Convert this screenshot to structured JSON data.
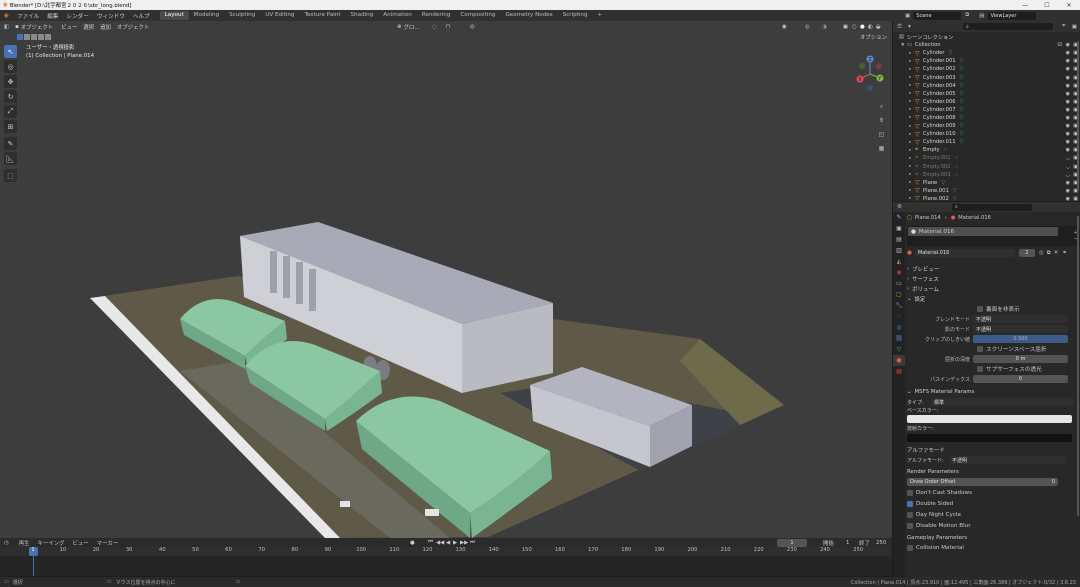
{
  "window": {
    "title": "Blender* [D:\\北宇都宮２０２６\\sbr_long.blend]",
    "controls": [
      "—",
      "☐",
      "✕"
    ]
  },
  "menu": {
    "items": [
      "ファイル",
      "編集",
      "レンダー",
      "ウィンドウ",
      "ヘルプ"
    ]
  },
  "workspaces": {
    "tabs": [
      "Layout",
      "Modeling",
      "Sculpting",
      "UV Editing",
      "Texture Paint",
      "Shading",
      "Animation",
      "Rendering",
      "Compositing",
      "Geometry Nodes",
      "Scripting"
    ],
    "active": "Layout",
    "add": "+"
  },
  "top_right": {
    "scene": "Scene",
    "view_layer": "ViewLayer"
  },
  "viewport": {
    "mode": "オブジェクト",
    "menus": [
      "ビュー",
      "選択",
      "追加",
      "オブジェクト"
    ],
    "transform": "グロ...",
    "options": "オプション",
    "info_line1": "ユーザー・透視投影",
    "info_line2": "(1) Collection | Plane.014",
    "gizmo_axes": {
      "x": "X",
      "y": "Y",
      "z": "Z"
    }
  },
  "toolbar": {
    "tools": [
      "select-tool",
      "cursor-tool",
      "move-tool",
      "rotate-tool",
      "scale-tool",
      "transform-tool",
      "annotate-tool",
      "measure-tool",
      "add-cube-tool"
    ]
  },
  "timeline": {
    "menus": [
      "再生",
      "キーイング",
      "ビュー",
      "マーカー"
    ],
    "current_frame": "1",
    "start_label": "開始",
    "start": "1",
    "end_label": "終了",
    "end": "250",
    "ticks": [
      "1",
      "10",
      "20",
      "30",
      "40",
      "50",
      "60",
      "70",
      "80",
      "90",
      "100",
      "110",
      "120",
      "130",
      "140",
      "150",
      "160",
      "170",
      "180",
      "190",
      "200",
      "210",
      "220",
      "230",
      "240",
      "250"
    ]
  },
  "statusbar": {
    "left": "選択",
    "mid": "マウス位置を視点の中心に",
    "right": "Collection | Plane.014 | 頂点:23,910 | 面:12,495 | 三角面:26,389 | オブジェクト:0/32 | 3.6.23"
  },
  "outliner": {
    "root": "シーンコレクション",
    "collection": "Collection",
    "items": [
      {
        "name": "Cylinder",
        "kind": "mesh",
        "visible": true
      },
      {
        "name": "Cylinder.001",
        "kind": "mesh",
        "visible": true
      },
      {
        "name": "Cylinder.002",
        "kind": "mesh",
        "visible": true
      },
      {
        "name": "Cylinder.003",
        "kind": "mesh",
        "visible": true
      },
      {
        "name": "Cylinder.004",
        "kind": "mesh",
        "visible": true
      },
      {
        "name": "Cylinder.005",
        "kind": "mesh",
        "visible": true
      },
      {
        "name": "Cylinder.006",
        "kind": "mesh",
        "visible": true
      },
      {
        "name": "Cylinder.007",
        "kind": "mesh",
        "visible": true
      },
      {
        "name": "Cylinder.008",
        "kind": "mesh",
        "visible": true
      },
      {
        "name": "Cylinder.009",
        "kind": "mesh",
        "visible": true
      },
      {
        "name": "Cylinder.010",
        "kind": "mesh",
        "visible": true
      },
      {
        "name": "Cylinder.011",
        "kind": "mesh",
        "visible": true
      },
      {
        "name": "Empty",
        "kind": "empty",
        "visible": true
      },
      {
        "name": "Empty.001",
        "kind": "empty",
        "visible": false
      },
      {
        "name": "Empty.002",
        "kind": "empty",
        "visible": false
      },
      {
        "name": "Empty.003",
        "kind": "empty",
        "visible": false
      },
      {
        "name": "Plane",
        "kind": "mesh",
        "visible": true
      },
      {
        "name": "Plane.001",
        "kind": "mesh",
        "visible": true
      },
      {
        "name": "Plane.002",
        "kind": "mesh",
        "visible": true
      }
    ]
  },
  "properties": {
    "breadcrumb_object": "Plane.014",
    "breadcrumb_material": "Material.016",
    "slot_name": "Material.016",
    "material_name": "Material.016",
    "users": "2",
    "sections": {
      "preview": "プレビュー",
      "surface": "サーフェス",
      "volume": "ボリューム",
      "settings": "設定"
    },
    "backface_culling": "裏面を非表示",
    "blend_mode_label": "ブレンドモード",
    "blend_mode": "不透明",
    "shadow_mode_label": "影のモード",
    "shadow_mode": "不透明",
    "clip_threshold_label": "クリップのしきい値",
    "clip_threshold": "0.500",
    "screen_space_refraction": "スクリーンスペース屈折",
    "refraction_depth_label": "屈折の深度",
    "refraction_depth": "0 m",
    "subsurface_translucency": "サブサーフェスの透光",
    "pass_index_label": "パスインデックス",
    "pass_index": "0",
    "msfs_header": "MSFS Material Params",
    "type_label": "タイプ:",
    "type_value": "標準",
    "base_color_label": "ベースカラー:",
    "base_color": "#e6e6e6",
    "emissive_label": "放射カラー:",
    "emissive_color": "#111111",
    "alpha_mode_header": "アルファモード",
    "alpha_mode_label": "アルファモード:",
    "alpha_mode_value": "不透明",
    "render_params_header": "Render Parameters",
    "draw_order_label": "Draw Order Offset",
    "draw_order_value": "0",
    "dont_cast_shadows": "Don't Cast Shadows",
    "double_sided": "Double Sided",
    "day_night_cycle": "Day Night Cycle",
    "disable_motion_blur": "Disable Motion Blur",
    "gameplay_header": "Gameplay Parameters",
    "collision_material": "Collision Material"
  }
}
